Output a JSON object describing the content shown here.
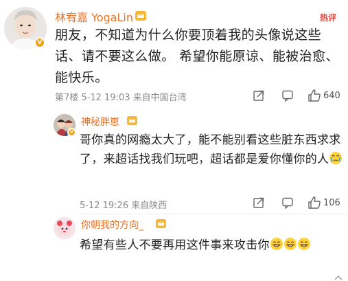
{
  "comments": [
    {
      "username": "林宥嘉 YogaLin",
      "text": "朋友，不知道为什么你要顶着我的头像说这些话、请不要这么做。 希望你能原谅、能被治愈、能快乐。",
      "meta": "第7楼 5-12 19:03 来自中国台湾",
      "likes": "640",
      "badge": "热评"
    },
    {
      "username": "神秘胖崽",
      "text": "哥你真的网瘾太大了，能不能别看这些脏东西求求了，来超话找我们玩吧，超话都是爱你懂你的人",
      "meta": "5-12 19:26 来自陕西",
      "likes": "106"
    },
    {
      "username": "你朝我的方向_",
      "text": "希望有些人不要再用这件事来攻击你"
    }
  ],
  "colors": {
    "username": "#e8742a",
    "hot": "#e8433c",
    "meta": "#8a8a8a",
    "vip": "#f0a11a"
  }
}
